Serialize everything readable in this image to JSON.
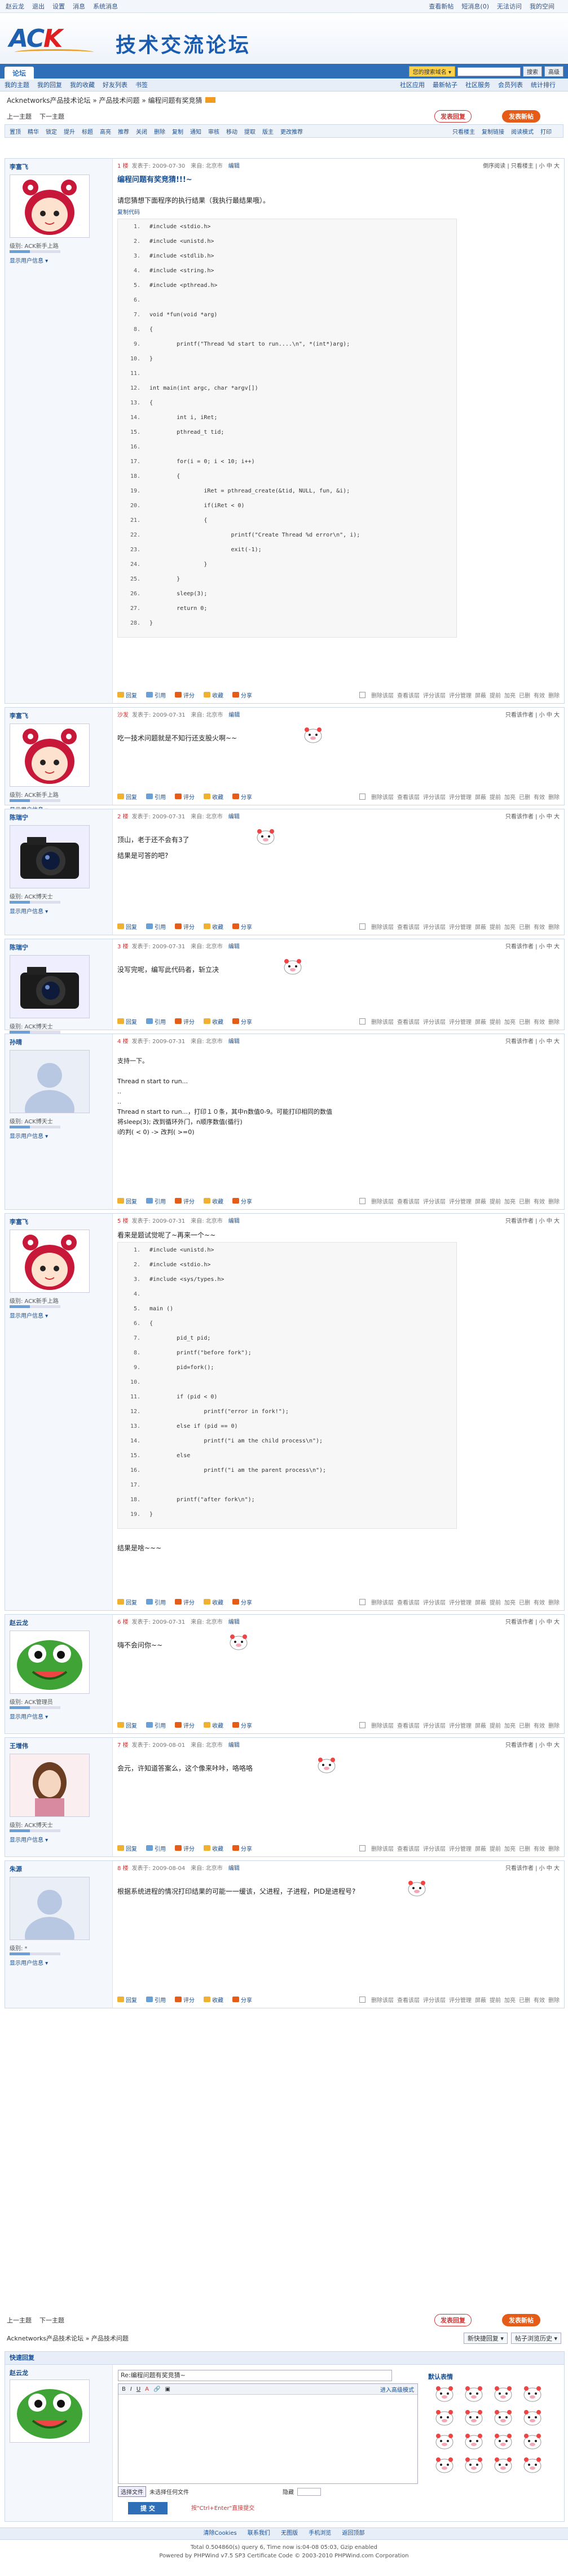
{
  "userbar": {
    "user": "赵云龙",
    "items": [
      "退出",
      "设置",
      "消息",
      "系统消息"
    ],
    "right": [
      "查看新帖",
      "短消息(0)",
      "无法访问",
      "我的空间"
    ]
  },
  "header": {
    "logo": "ACK",
    "site_title": "技术交流论坛"
  },
  "nav": {
    "tab": "论坛",
    "select": "您的搜索域名 ▾",
    "search_btn": "搜索",
    "search_btn2": "高级"
  },
  "subnav": {
    "left": [
      "我的主题",
      "我的回复",
      "我的收藏",
      "好友列表",
      "书签"
    ],
    "right": [
      "社区应用",
      "最新帖子",
      "社区服务",
      "会员列表",
      "统计排行"
    ]
  },
  "breadcrumb": "Acknetworks产品技术论坛 » 产品技术问题 » 编程问题有奖竞猜",
  "pager": {
    "prev": "上一主题",
    "next": "下一主题",
    "reply_btn": "发表回复",
    "new_btn": "发表新帖"
  },
  "toolbar": {
    "items": [
      "置顶",
      "精华",
      "锁定",
      "提升",
      "标题",
      "高亮",
      "推荐",
      "关闭",
      "删除",
      "复制",
      "通知",
      "审核",
      "移动",
      "提取",
      "版主",
      "更改推荐"
    ],
    "right": [
      "只看楼主",
      "复制链接",
      "阅读模式",
      "打印"
    ]
  },
  "posts": [
    {
      "user": "李富飞",
      "floor": "1 楼",
      "time": "发表于: 2009-07-30",
      "extra": "来自: 北京市",
      "edit": "编辑",
      "right": "倒序阅读 | 只看楼主 | 小 中 大",
      "title": "编程问题有奖竞猜!!!~",
      "intro": "请您猜想下面程序的执行结果（我执行最结果哦）。",
      "copy": "复制代码",
      "code": [
        "#include <stdio.h>",
        "#include <unistd.h>",
        "#include <stdlib.h>",
        "#include <string.h>",
        "#include <pthread.h>",
        "",
        "void *fun(void *arg)",
        "{",
        "        printf(\"Thread %d start to run....\\n\", *(int*)arg);",
        "}",
        "",
        "int main(int argc, char *argv[])",
        "{",
        "        int i, iRet;",
        "        pthread_t tid;",
        "",
        "        for(i = 0; i < 10; i++)",
        "        {",
        "                iRet = pthread_create(&tid, NULL, fun, &i);",
        "                if(iRet < 0)",
        "                {",
        "                        printf(\"Create Thread %d error\\n\", i);",
        "                        exit(-1);",
        "                }",
        "        }",
        "        sleep(3);",
        "        return 0;",
        "}"
      ],
      "rank": "级别: ACK新手上路",
      "detail": "显示用户信息 ▾"
    },
    {
      "user": "李富飞",
      "floor": "沙发",
      "time": "发表于: 2009-07-31",
      "extra": "来自: 北京市",
      "edit": "编辑",
      "right": "只看该作者 | 小 中 大",
      "body": "吃一技术问题就是不知行还支股火啊~~",
      "rank": "级别: ACK新手上路",
      "detail": "显示用户信息 ▾"
    },
    {
      "user": "陈瑞宁",
      "floor": "2 楼",
      "time": "发表于: 2009-07-31",
      "extra": "来自: 北京市",
      "edit": "编辑",
      "right": "只看该作者 | 小 中 大",
      "body": "顶山，老于还不会有3了",
      "body2": "结果是可答的吧?",
      "rank": "级别: ACK博天士",
      "detail": "显示用户信息 ▾"
    },
    {
      "user": "陈瑞宁",
      "floor": "3 楼",
      "time": "发表于: 2009-07-31",
      "extra": "来自: 北京市",
      "edit": "编辑",
      "right": "只看该作者 | 小 中 大",
      "body": "没写完呢，编写此代码者，斩立决",
      "rank": "级别: ACK博天士",
      "detail": "显示用户信息 ▾"
    },
    {
      "user": "孙晴",
      "floor": "4 楼",
      "time": "发表于: 2009-07-31",
      "extra": "来自: 北京市",
      "edit": "编辑",
      "right": "只看该作者 | 小 中 大",
      "lines": [
        "支持一下。",
        "",
        "Thread n start to run...",
        "..",
        "..",
        "Thread n start to run...，打印１０条，其中n数值0-9。可能打印相同的数值",
        "将sleep(3); 改到循环外门，n顺序数值(循行)",
        "   i的判( < 0)  ->  改判( >=0)"
      ],
      "rank": "级别: ACK博天士",
      "detail": "显示用户信息 ▾"
    },
    {
      "user": "李富飞",
      "floor": "5 楼",
      "time": "发表于: 2009-07-31",
      "extra": "来自: 北京市",
      "edit": "编辑",
      "right": "只看该作者 | 小 中 大",
      "intro": "看来是题试觉呢了~再来一个~~",
      "code": [
        "#include <unistd.h>",
        "#include <stdio.h>",
        "#include <sys/types.h>",
        "",
        "main ()",
        "{",
        "        pid_t pid;",
        "        printf(\"before fork\");",
        "        pid=fork();",
        "",
        "        if (pid < 0)",
        "                printf(\"error in fork!\");",
        "        else if (pid == 0)",
        "                printf(\"i am the child process\\n\");",
        "        else",
        "                printf(\"i am the parent process\\n\");",
        "",
        "        printf(\"after fork\\n\");",
        "}"
      ],
      "after": "结果是啥~~~",
      "rank": "级别: ACK新手上路",
      "detail": "显示用户信息 ▾"
    },
    {
      "user": "赵云龙",
      "floor": "6 楼",
      "time": "发表于: 2009-07-31",
      "extra": "来自: 北京市",
      "edit": "编辑",
      "right": "只看该作者 | 小 中 大",
      "body": "嗨不会问你~~",
      "rank": "级别: ACK管理员",
      "detail": "显示用户信息 ▾"
    },
    {
      "user": "王增伟",
      "floor": "7 楼",
      "time": "发表于: 2009-08-01",
      "extra": "来自: 北京市",
      "edit": "编辑",
      "right": "只看该作者 | 小 中 大",
      "body": "会元，许知道答案么，这个像来咔咔，咯咯咯",
      "rank": "级别: ACK博天士",
      "detail": "显示用户信息 ▾"
    },
    {
      "user": "朱源",
      "floor": "8 楼",
      "time": "发表于: 2009-08-04",
      "extra": "来自: 北京市",
      "edit": "编辑",
      "right": "只看该作者 | 小 中 大",
      "body": "根据系统进程的情况打印结果的可能一一缓该，父进程，子进程，PID是进程号?",
      "rank": "级别: *",
      "detail": "显示用户信息 ▾"
    }
  ],
  "foot_actions": [
    "回复",
    "引用",
    "评分",
    "收藏",
    "分享"
  ],
  "foot_mgr": [
    "删除该层",
    "查看该层",
    "评分该层",
    "评分管理",
    "屏蔽",
    "提前",
    "加亮",
    "已删",
    "有效",
    "删除"
  ],
  "bottom_pager": {
    "prev": "上一主题",
    "next": "下一主题",
    "reply_btn": "发表回复",
    "new_btn": "发表新帖",
    "breadcrumb": "Acknetworks产品技术论坛 » 产品技术问题",
    "btn_a": "新快捷回复 ▾",
    "btn_b": "帖子浏览历史 ▾"
  },
  "quick_reply": {
    "title": "快速回复",
    "user": "赵云龙",
    "subject": "Re:编程问题有奖竞猜~",
    "toggle": "进入高级模式",
    "emoji_title": "默认表情",
    "upload": "选择文件",
    "upload2": "未选择任何文件",
    "submit": "提 交",
    "hint": "按\"Ctrl+Enter\"直接提交",
    "check": "隐藏"
  },
  "footer": {
    "links": [
      "清除Cookies",
      "联系我们",
      "无图版",
      "手机浏览",
      "返回顶部"
    ],
    "line1": "Total 0.504860(s) query 6, Time now is:04-08 05:03, Gzip enabled",
    "line2": "Powered by PHPWind v7.5 SP3 Certificate Code © 2003-2010 PHPWind.com Corporation"
  }
}
